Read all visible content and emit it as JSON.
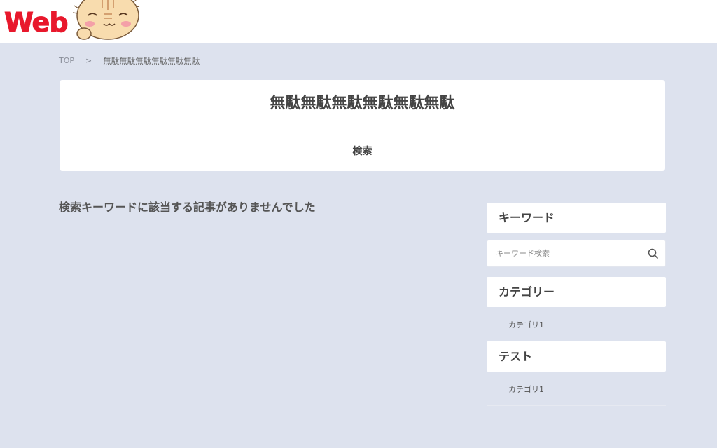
{
  "header": {
    "logo_text": "Web"
  },
  "breadcrumb": {
    "home": "TOP",
    "separator": ">",
    "current": "無駄無駄無駄無駄無駄無駄"
  },
  "title_card": {
    "title": "無駄無駄無駄無駄無駄無駄",
    "subtitle": "検索"
  },
  "main": {
    "message": "検索キーワードに該当する記事がありませんでした"
  },
  "sidebar": {
    "keyword_heading": "キーワード",
    "search_placeholder": "キーワード検索",
    "category_heading": "カテゴリー",
    "category_items": [
      "カテゴリ1"
    ],
    "test_heading": "テスト",
    "test_items": [
      "カテゴリ1"
    ]
  },
  "colors": {
    "background": "#dde2ee",
    "logo_red": "#e8182c",
    "card": "#ffffff"
  },
  "icons": {
    "search": "search-icon",
    "mascot": "cat-mascot-icon"
  }
}
